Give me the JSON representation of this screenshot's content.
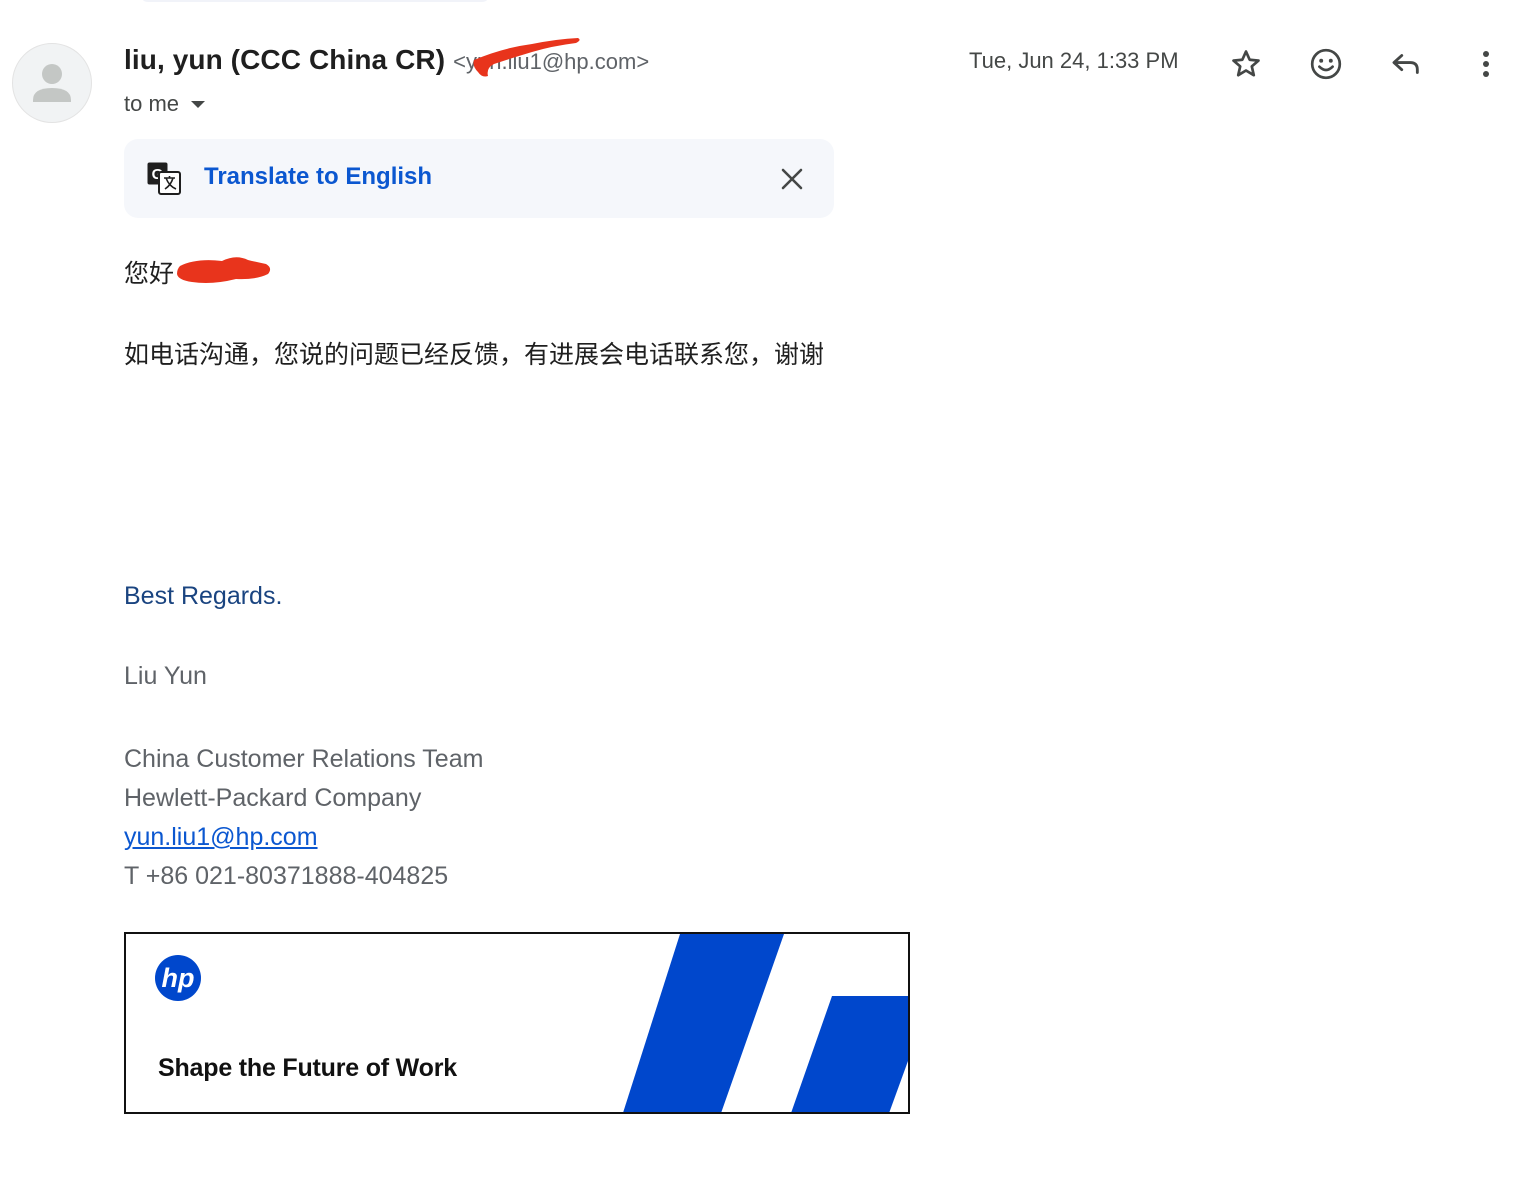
{
  "header": {
    "sender_name": "liu, yun (CCC China CR)",
    "sender_email": "<yun.liu1@hp.com>",
    "to_label": "to me",
    "date": "Tue, Jun 24, 1:33 PM",
    "icons": [
      "star-icon",
      "emoji-reaction-icon",
      "reply-icon",
      "more-vert-icon"
    ]
  },
  "translate_bar": {
    "link_label": "Translate to English",
    "icon": "translate-icon",
    "close_icon": "close-icon"
  },
  "body": {
    "greeting": "您好",
    "message": "如电话沟通，您说的问题已经反馈，有进展会电话联系您，谢谢"
  },
  "signature": {
    "regards": "Best Regards.",
    "name": "Liu Yun",
    "team": "China Customer Relations Team",
    "company": "Hewlett-Packard Company",
    "email": "yun.liu1@hp.com",
    "phone": "T +86 021-80371888-404825"
  },
  "banner": {
    "logo_text": "hp",
    "tagline": "Shape the Future of Work",
    "brand_color": "#0047cc"
  },
  "colors": {
    "link_blue": "#0b57d0",
    "regards_blue": "#1a4480",
    "redaction_red": "#e8341c",
    "translate_bg": "#f5f7fb"
  }
}
